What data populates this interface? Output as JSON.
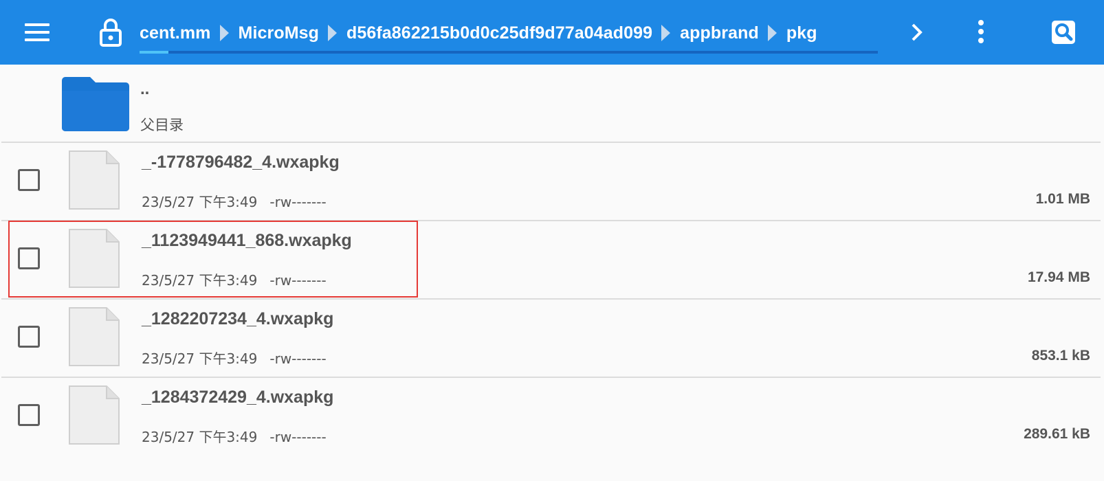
{
  "toolbar": {
    "menu_icon": "hamburger-menu-icon",
    "lock_icon": "lock-icon",
    "breadcrumb": [
      "cent.mm",
      "MicroMsg",
      "d56fa862215b0d0c25df9d77a04ad099",
      "appbrand",
      "pkg"
    ],
    "more_icon": "chevron-right-icon",
    "overflow_icon": "more-vertical-icon",
    "search_icon": "search-icon",
    "accent": "#1e88e5"
  },
  "parent_row": {
    "name": "..",
    "label": "父目录",
    "icon": "folder-icon"
  },
  "files": [
    {
      "name": "_-1778796482_4.wxapkg",
      "date": "23/5/27 下午3:49",
      "perms": "-rw-------",
      "size": "1.01 MB"
    },
    {
      "name": "_1123949441_868.wxapkg",
      "date": "23/5/27 下午3:49",
      "perms": "-rw-------",
      "size": "17.94 MB"
    },
    {
      "name": "_1282207234_4.wxapkg",
      "date": "23/5/27 下午3:49",
      "perms": "-rw-------",
      "size": "853.1 kB"
    },
    {
      "name": "_1284372429_4.wxapkg",
      "date": "23/5/27 下午3:49",
      "perms": "-rw-------",
      "size": "289.61 kB"
    }
  ],
  "highlight_color": "#e53935"
}
